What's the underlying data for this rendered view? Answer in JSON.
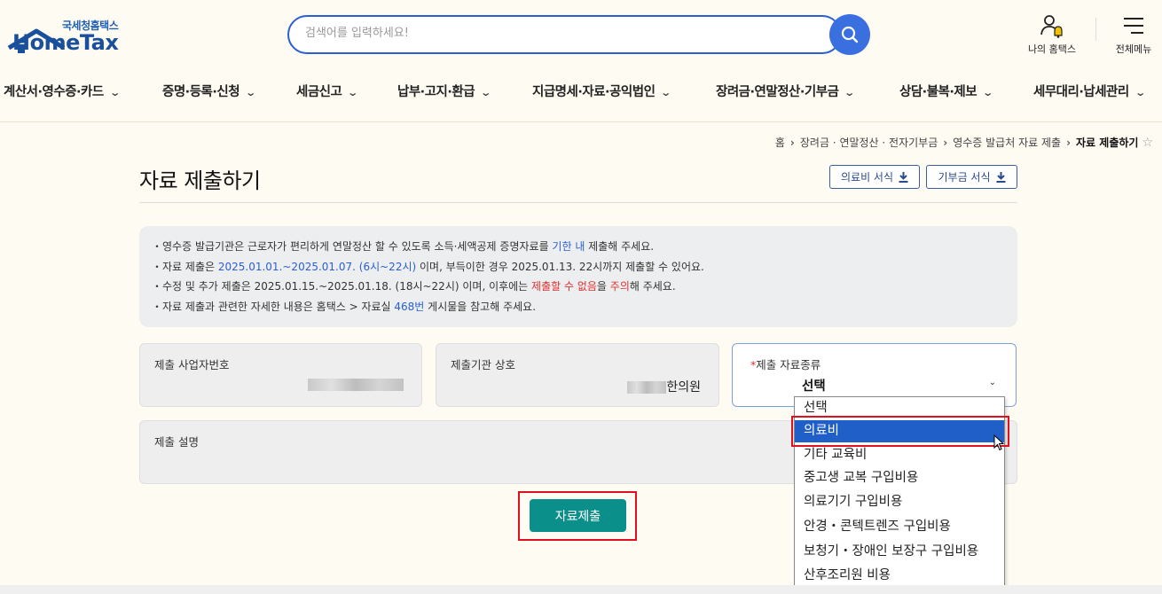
{
  "header": {
    "logo_sub": "국세청홈택스",
    "logo_main": "HomeTax",
    "search_placeholder": "검색어를 입력하세요!",
    "my_hometax": "나의 홈택스",
    "all_menu": "전체메뉴"
  },
  "gnb": [
    "계산서·영수증·카드",
    "증명·등록·신청",
    "세금신고",
    "납부·고지·환급",
    "지급명세·자료·공익법인",
    "장려금·연말정산·기부금",
    "상담·불복·제보",
    "세무대리·납세관리"
  ],
  "breadcrumb": {
    "items": [
      "홈",
      "장려금 · 연말정산 · 전자기부금",
      "영수증 발급처 자료 제출"
    ],
    "current": "자료 제출하기"
  },
  "page": {
    "title": "자료 제출하기",
    "medical_form_btn": "의료비 서식",
    "donation_form_btn": "기부금 서식"
  },
  "info": {
    "line1_a": "영수증 발급기관은 근로자가 편리하게 연말정산 할 수 있도록 소득·세액공제 증명자료를 ",
    "line1_b": "기한 내",
    "line1_c": " 제출해 주세요.",
    "line2_a": "자료 제출은 ",
    "line2_b": "2025.01.01.~2025.01.07. (6시~22시)",
    "line2_c": " 이며, 부득이한 경우 2025.01.13. 22시까지 제출할 수 있어요.",
    "line3_a": "수정 및 추가 제출은 2025.01.15.~2025.01.18. (18시~22시) 이며, 이후에는 ",
    "line3_b": "제출할 수 없음",
    "line3_c": "을 ",
    "line3_d": "주의",
    "line3_e": "해 주세요.",
    "line4_a": "자료 제출과 관련한 자세한 내용은 홈택스 > 자료실 ",
    "line4_b": "468번",
    "line4_c": " 게시물을 참고해 주세요."
  },
  "fields": {
    "biz_no_label": "제출 사업자번호",
    "org_name_label": "제출기관 상호",
    "org_name_suffix": "한의원",
    "type_label": "제출 자료종류",
    "type_required": "*",
    "type_value": "선택",
    "desc_label": "제출 설명"
  },
  "dropdown": {
    "options": [
      "선택",
      "의료비",
      "기타 교육비",
      "중고생 교복 구입비용",
      "의료기기 구입비용",
      "안경・콘텍트렌즈 구입비용",
      "보청기・장애인 보장구 구입비용",
      "산후조리원 비용"
    ],
    "highlighted_index": 1
  },
  "submit_label": "자료제출",
  "colors": {
    "accent_blue": "#2a5fd3",
    "teal_button": "#0a8f8a",
    "highlight_red": "#e0101f",
    "selected_option": "#1f5fc7"
  }
}
